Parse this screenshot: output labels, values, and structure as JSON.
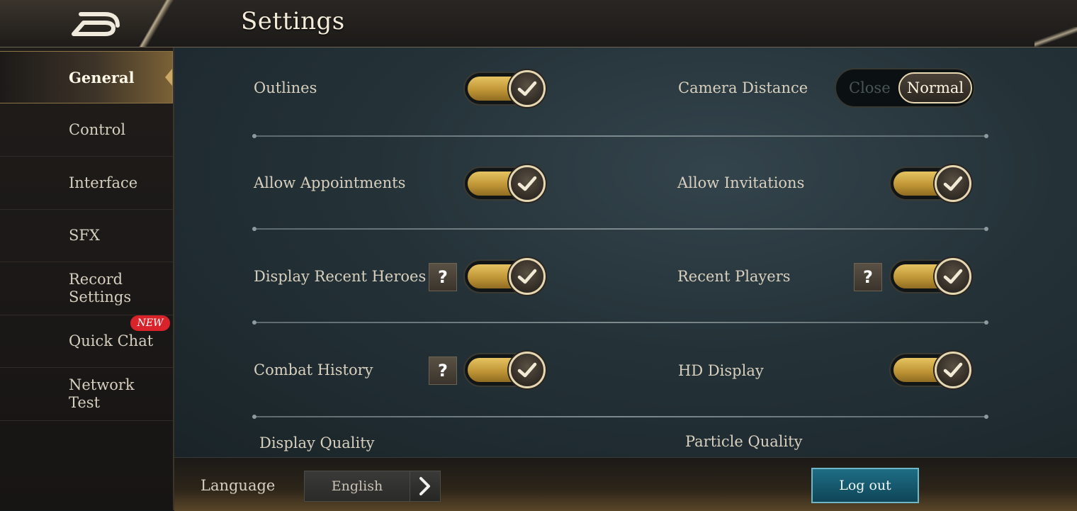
{
  "header": {
    "title": "Settings"
  },
  "sidebar": {
    "items": [
      {
        "label": "General"
      },
      {
        "label": "Control"
      },
      {
        "label": "Interface"
      },
      {
        "label": "SFX"
      },
      {
        "label": "Record Settings"
      },
      {
        "label": "Quick Chat",
        "badge": "NEW"
      },
      {
        "label": "Network Test"
      }
    ]
  },
  "settings": {
    "outlines": {
      "label": "Outlines",
      "state": "on"
    },
    "camera_distance": {
      "label": "Camera Distance",
      "options": [
        "Close",
        "Normal"
      ],
      "selected": "Normal"
    },
    "allow_appointments": {
      "label": "Allow Appointments",
      "state": "on"
    },
    "allow_invitations": {
      "label": "Allow Invitations",
      "state": "on"
    },
    "display_recent_heroes": {
      "label": "Display Recent Heroes",
      "help": "?",
      "state": "on"
    },
    "recent_players": {
      "label": "Recent Players",
      "help": "?",
      "state": "on"
    },
    "combat_history": {
      "label": "Combat History",
      "help": "?",
      "state": "on"
    },
    "hd_display": {
      "label": "HD Display",
      "state": "on"
    },
    "display_quality": {
      "label": "Display Quality"
    },
    "particle_quality": {
      "label": "Particle Quality"
    }
  },
  "footer": {
    "language_label": "Language",
    "language_value": "English",
    "logout_label": "Log out"
  },
  "colors": {
    "accent_gold": "#c9a868",
    "toggle_fill": "#d4ad4a",
    "logout_teal": "#1e6d85",
    "new_badge": "#d8232a"
  }
}
